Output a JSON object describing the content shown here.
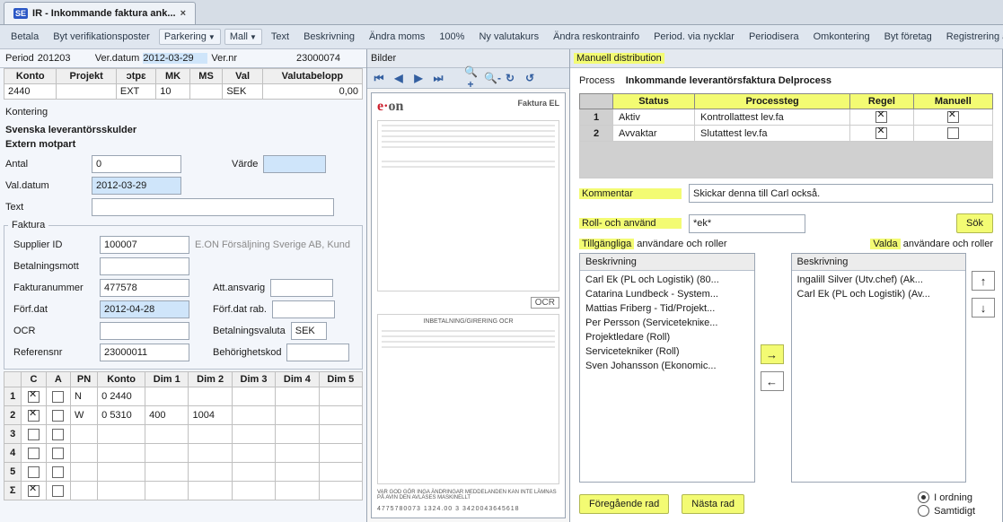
{
  "tab": {
    "prefix": "SE",
    "title": "IR - Inkommande faktura ank..."
  },
  "menu": {
    "items": [
      {
        "label": "Betala"
      },
      {
        "label": "Byt verifikationsposter"
      },
      {
        "label": "Parkering",
        "dd": true,
        "active": true
      },
      {
        "label": "Mall",
        "dd": true,
        "active": true
      },
      {
        "label": "Text"
      },
      {
        "label": "Beskrivning"
      },
      {
        "label": "Ändra moms"
      },
      {
        "label": "100%"
      },
      {
        "label": "Ny valutakurs"
      },
      {
        "label": "Ändra reskontrainfo"
      },
      {
        "label": "Period. via nycklar"
      },
      {
        "label": "Periodisera"
      },
      {
        "label": "Omkontering"
      },
      {
        "label": "Byt företag"
      },
      {
        "label": "Registrering av doku"
      }
    ]
  },
  "periodbar": {
    "period_lbl": "Period",
    "period": "201203",
    "verdatum_lbl": "Ver.datum",
    "verdatum": "2012-03-29",
    "vernr_lbl": "Ver.nr",
    "vernr": "23000074"
  },
  "kontogrid": {
    "headers": [
      "Konto",
      "Projekt",
      "ɔtpɛ",
      "MK",
      "MS",
      "Val",
      "Valutabelopp"
    ],
    "row": {
      "konto": "2440",
      "projekt": "",
      "otp": "EXT",
      "mk": "10",
      "ms": "",
      "val": "SEK",
      "belopp": "0,00"
    }
  },
  "kontering": {
    "title": "Kontering",
    "line1": "Svenska leverantörsskulder",
    "line2": "Extern motpart"
  },
  "fields": {
    "antal_lbl": "Antal",
    "antal": "0",
    "varde_lbl": "Värde",
    "varde": "",
    "valdatum_lbl": "Val.datum",
    "valdatum": "2012-03-29",
    "text_lbl": "Text",
    "text": ""
  },
  "faktura": {
    "legend": "Faktura",
    "supplier_lbl": "Supplier ID",
    "supplier": "100007",
    "supplier_name": "E.ON Försäljning Sverige AB, Kund",
    "betmott_lbl": "Betalningsmott",
    "faktnr_lbl": "Fakturanummer",
    "faktnr": "477578",
    "attansv_lbl": "Att.ansvarig",
    "forf_lbl": "Förf.dat",
    "forf": "2012-04-28",
    "forfrab_lbl": "Förf.dat rab.",
    "ocr_lbl": "OCR",
    "betval_lbl": "Betalningsvaluta",
    "betval": "SEK",
    "ref_lbl": "Referensnr",
    "ref": "23000011",
    "beh_lbl": "Behörighetskod"
  },
  "rowsgrid": {
    "headers": [
      "",
      "C",
      "A",
      "PN",
      "Konto",
      "Dim 1",
      "Dim 2",
      "Dim 3",
      "Dim 4",
      "Dim 5"
    ],
    "rows": [
      {
        "idx": "1",
        "c": true,
        "a": false,
        "pn": "N",
        "konto": "0 2440",
        "d1": "",
        "d2": "",
        "d3": "",
        "d4": "",
        "d5": ""
      },
      {
        "idx": "2",
        "c": true,
        "a": false,
        "pn": "W",
        "konto": "0 5310",
        "d1": "400",
        "d2": "1004",
        "d3": "",
        "d4": "",
        "d5": ""
      },
      {
        "idx": "3",
        "c": false,
        "a": false,
        "pn": "",
        "konto": "",
        "d1": "",
        "d2": "",
        "d3": "",
        "d4": "",
        "d5": ""
      },
      {
        "idx": "4",
        "c": false,
        "a": false,
        "pn": "",
        "konto": "",
        "d1": "",
        "d2": "",
        "d3": "",
        "d4": "",
        "d5": ""
      },
      {
        "idx": "5",
        "c": false,
        "a": false,
        "pn": "",
        "konto": "",
        "d1": "",
        "d2": "",
        "d3": "",
        "d4": "",
        "d5": ""
      }
    ],
    "sigma": "Σ"
  },
  "mid": {
    "title": "Bilder",
    "inv_title": "Faktura EL",
    "logo_l": "e·",
    "logo_r": "on",
    "ocr": "OCR",
    "inbet": "INBETALNING/GIRERING  OCR",
    "footer": "VAR GOD GÖR INGA ÄNDRINGAR    MEDDELANDEN KAN INTE LÄMNAS PÅ AVIN  DEN AVLÄSES MASKINELLT",
    "barcode": "4775780073   1324.00  3     3420043645618"
  },
  "right": {
    "title": "Manuell distribution",
    "process_lbl": "Process",
    "process": "Inkommande leverantörsfaktura Delprocess",
    "steps": {
      "headers": {
        "idx": "",
        "status": "Status",
        "steg": "Processteg",
        "regel": "Regel",
        "man": "Manuell"
      },
      "rows": [
        {
          "idx": "1",
          "status": "Aktiv",
          "steg": "Kontrollattest lev.fa",
          "regel": true,
          "man": true
        },
        {
          "idx": "2",
          "status": "Avvaktar",
          "steg": "Slutattest lev.fa",
          "regel": true,
          "man": false
        }
      ]
    },
    "kommentar_lbl": "Kommentar",
    "kommentar": "Skickar denna till Carl också.",
    "roll_lbl": "Roll- och använd",
    "roll": "*ek*",
    "sok": "Sök",
    "tillg_lbl": "Tillgängliga",
    "tillg_suffix": " användare och roller",
    "valda_lbl": "Valda",
    "valda_suffix": " användare och roller",
    "beskrivning": "Beskrivning",
    "left_list": [
      "Carl Ek (PL och Logistik) (80...",
      "Catarina Lundbeck - System...",
      "Mattias Friberg - Tid/Projekt...",
      "Per Persson (Servicetekniке...",
      "Projektledare (Roll)",
      "Servicetekniker (Roll)",
      "Sven Johansson (Ekonomic..."
    ],
    "right_list": [
      "Ingalill Silver (Utv.chef) (Ak...",
      "Carl Ek (PL och Logistik) (Av..."
    ],
    "prev": "Föregående rad",
    "next": "Nästa rad",
    "radio1": "I ordning",
    "radio2": "Samtidigt"
  },
  "chart_data": null
}
